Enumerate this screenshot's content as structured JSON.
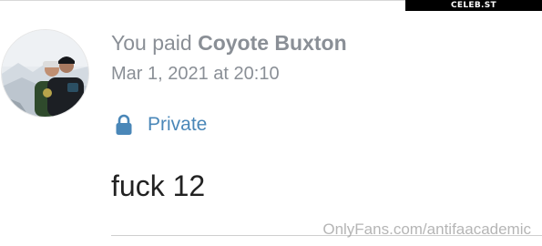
{
  "watermark_top": "CELEB.ST",
  "transaction": {
    "title_prefix": "You paid",
    "payee": "Coyote Buxton",
    "date": "Mar 1, 2021 at 20:10"
  },
  "privacy": {
    "icon": "lock-icon",
    "label": "Private"
  },
  "note": "fuck 12",
  "watermark_bottom": "OnlyFans.com/antifaacademic",
  "colors": {
    "muted_text": "#8a8f96",
    "accent_blue": "#4a87b8",
    "note_text": "#222222"
  }
}
